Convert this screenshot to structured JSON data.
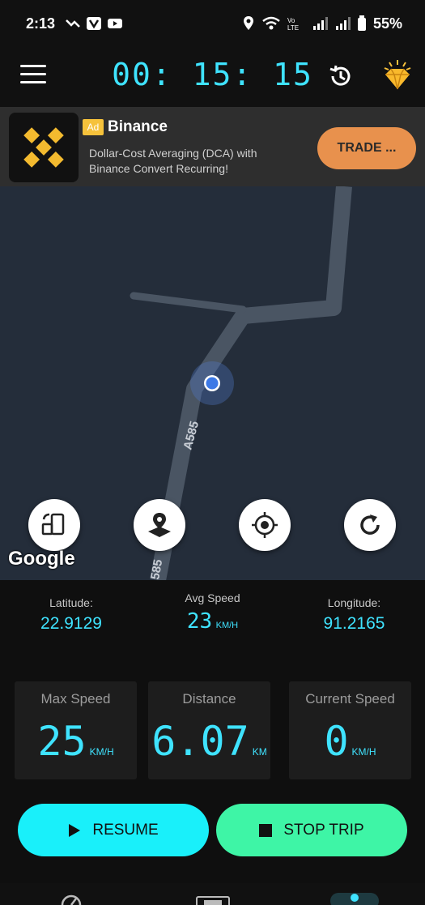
{
  "status_bar": {
    "time": "2:13",
    "battery": "55%"
  },
  "app_bar": {
    "timer": "00: 15: 15"
  },
  "ad": {
    "badge": "Ad",
    "title": "Binance",
    "description": "Dollar-Cost Averaging (DCA) with Binance Convert Recurring!",
    "cta": "TRADE ..."
  },
  "map": {
    "road_label": "A585",
    "road_label_2": "585",
    "attribution": "Google"
  },
  "stats": {
    "latitude": {
      "label": "Latitude:",
      "value": "22.9129"
    },
    "avg_speed": {
      "label": "Avg Speed",
      "value": "23",
      "unit": "KM/H"
    },
    "longitude": {
      "label": "Longitude:",
      "value": "91.2165"
    }
  },
  "cards": {
    "max_speed": {
      "label": "Max Speed",
      "value": "25",
      "unit": "KM/H"
    },
    "distance": {
      "label": "Distance",
      "value": "6.07",
      "unit": "KM"
    },
    "current_speed": {
      "label": "Current Speed",
      "value": "0",
      "unit": "KM/H"
    }
  },
  "buttons": {
    "resume": "RESUME",
    "stop": "STOP TRIP"
  },
  "colors": {
    "accent_cyan": "#3fe3ff",
    "resume_bg": "#19f0fa",
    "stop_bg": "#3ef5a6",
    "ad_cta": "#e8914d",
    "map_bg": "#242d3a"
  },
  "icons": [
    "menu-icon",
    "history-icon",
    "premium-diamond-icon",
    "rotate-screen-icon",
    "map-pin-icon",
    "my-location-icon",
    "refresh-icon",
    "play-icon",
    "stop-icon",
    "speedometer-nav-icon",
    "dashboard-nav-icon",
    "map-nav-icon"
  ]
}
